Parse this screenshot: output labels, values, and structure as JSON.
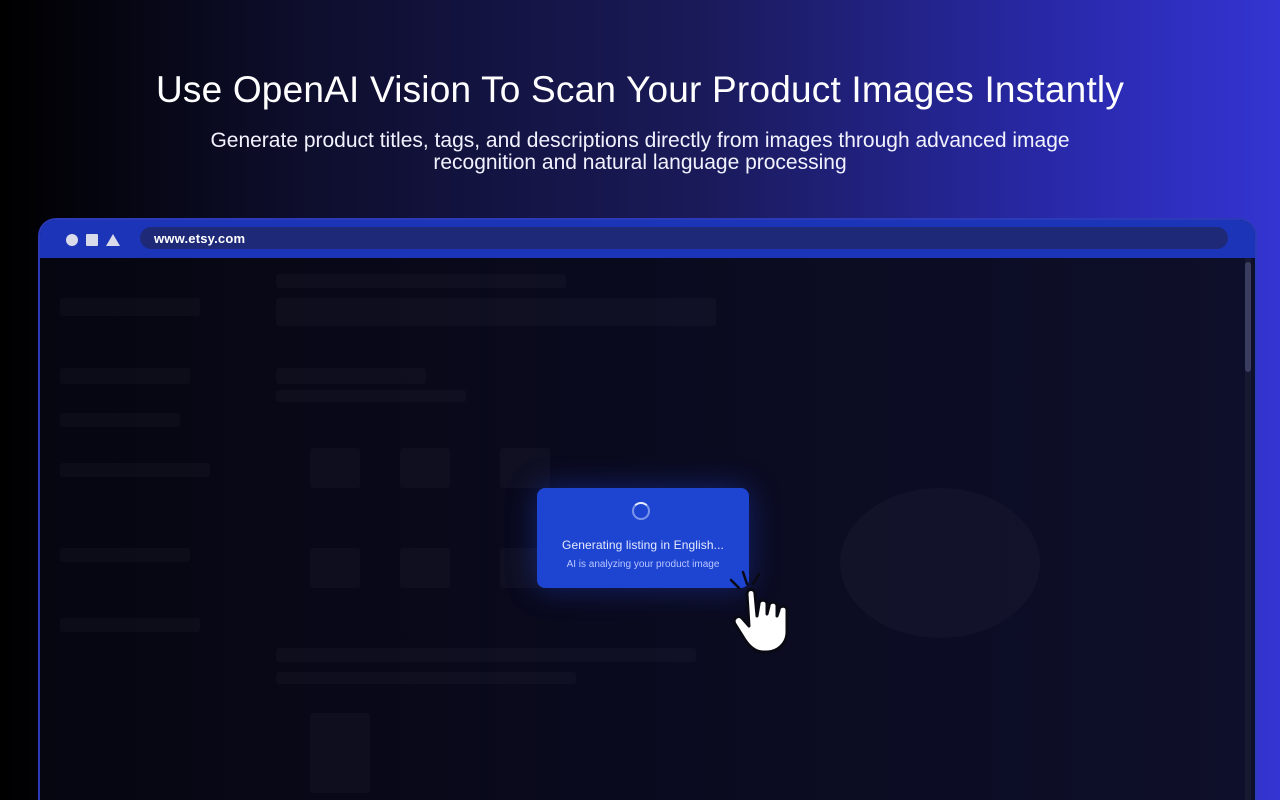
{
  "hero": {
    "title": "Use OpenAI Vision To Scan Your Product Images Instantly",
    "subtitle": "Generate product titles, tags, and descriptions directly from images through advanced image recognition and natural language processing"
  },
  "browser": {
    "controls": [
      "circle-icon",
      "square-icon",
      "triangle-icon"
    ],
    "address": "www.etsy.com"
  },
  "loading": {
    "title": "Generating listing in English...",
    "subtitle": "AI is analyzing your product image"
  },
  "colors": {
    "card": "#1e45d2",
    "browser_bar": "#1c34b8",
    "background_right": "#3434d2"
  },
  "icons": {
    "spinner": "loading-spinner-icon",
    "cursor": "hand-pointer-icon"
  }
}
